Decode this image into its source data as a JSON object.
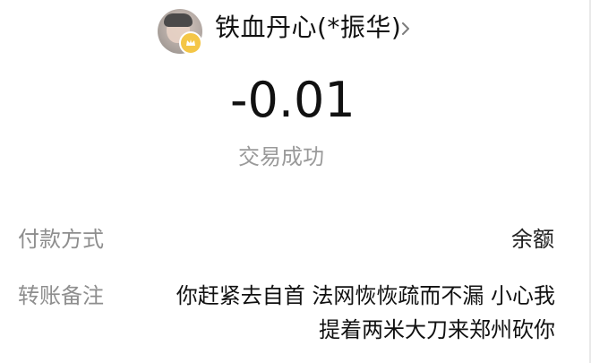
{
  "header": {
    "user_name": "铁血丹心(*振华)",
    "avatar_icon": "avatar-icon",
    "badge_icon": "crown-icon",
    "chevron_icon": "chevron-right-icon"
  },
  "transaction": {
    "amount": "-0.01",
    "status": "交易成功"
  },
  "details": {
    "payment_method_label": "付款方式",
    "payment_method_value": "余额",
    "remark_label": "转账备注",
    "remark_lines": [
      "你赶紧去自首 法网恢恢疏而不漏 小心我",
      "提着两米大刀来郑州砍你"
    ]
  },
  "colors": {
    "primary_text": "#111111",
    "secondary_text": "#8e8e8e",
    "status_text": "#9a9a9a",
    "badge": "#f4c647",
    "background": "#ffffff"
  }
}
